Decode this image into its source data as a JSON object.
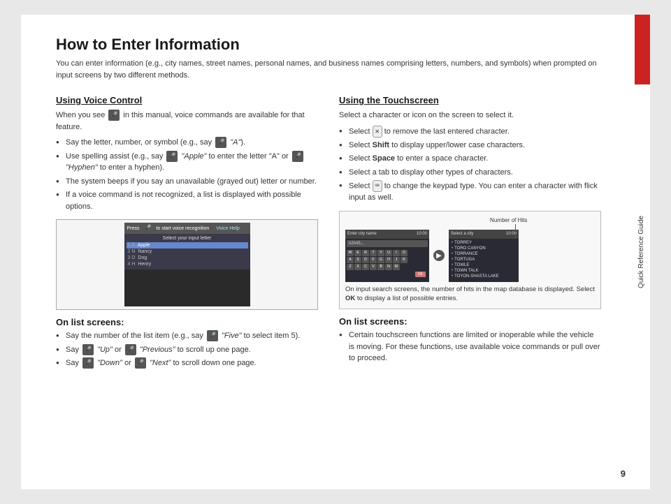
{
  "page": {
    "title": "How to Enter Information",
    "subtitle": "You can enter information (e.g., city names, street names, personal names, and business names comprising letters, numbers, and symbols) when prompted on input screens by two different methods.",
    "page_number": "9"
  },
  "side_label": "Quick Reference Guide",
  "left_col": {
    "section_title": "Using Voice Control",
    "intro": "When you see  in this manual, voice commands are available for that feature.",
    "bullets": [
      "Say the letter, number, or symbol (e.g., say  \"A\").",
      "Use spelling assist (e.g., say  \"Apple\" to enter the letter \"A\" or  \"Hyphen\" to enter a hyphen).",
      "The system beeps if you say an unavailable (grayed out) letter or number.",
      "If a voice command is not recognized, a list is displayed with possible options."
    ],
    "screenshot": {
      "topbar": "Press  to start voice recognition   Voice Help",
      "prompt": "Select your input letter",
      "items": [
        {
          "num": "1 A",
          "name": "Apple"
        },
        {
          "num": "2 N",
          "name": "Nancy"
        },
        {
          "num": "3 D",
          "name": "Dog"
        },
        {
          "num": "4 H",
          "name": "Henry"
        }
      ]
    },
    "on_list_title": "On list screens:",
    "on_list_bullets": [
      "Say the number of the list item (e.g., say  \"Five\" to select item 5).",
      "Say  \"Up\" or  \"Previous\" to scroll up one page.",
      "Say  \"Down\" or  \"Next\" to scroll down one page."
    ]
  },
  "right_col": {
    "section_title": "Using the Touchscreen",
    "intro": "Select a character or icon on the screen to select it.",
    "bullets": [
      "Select  to remove the last entered character.",
      "Select Shift to display upper/lower case characters.",
      "Select Space to enter a space character.",
      "Select a tab to display other types of characters.",
      "Select  to change the keypad type. You can enter a character with flick input as well."
    ],
    "diagram": {
      "number_of_hits_label": "Number of Hits",
      "caption": "On input search screens, the number of hits in the map database is displayed. Select OK to display a list of possible entries.",
      "screen1": {
        "topbar": "Enter city name",
        "time": "10:00",
        "input": "",
        "keyboard_rows": [
          [
            "W",
            "E",
            "R",
            "T",
            "Y",
            "U",
            "I",
            "O"
          ],
          [
            "A",
            "S",
            "D",
            "F",
            "G",
            "H",
            "J",
            "K"
          ],
          [
            "Z",
            "X",
            "C",
            "V",
            "B",
            "N",
            "M"
          ]
        ]
      },
      "screen2": {
        "topbar": "Select a city",
        "time": "10:00",
        "items": [
          "TORREY",
          "TORO CANYON",
          "TORRANCE",
          "TORTUGA",
          "TOWLE",
          "TOWN TALK",
          "TOYON-SHASTA LAKE"
        ]
      }
    },
    "on_list_title": "On list screens:",
    "on_list_bullets": [
      "Certain touchscreen functions are limited or inoperable while the vehicle is moving. For these functions, use available voice commands or pull over to proceed."
    ]
  }
}
